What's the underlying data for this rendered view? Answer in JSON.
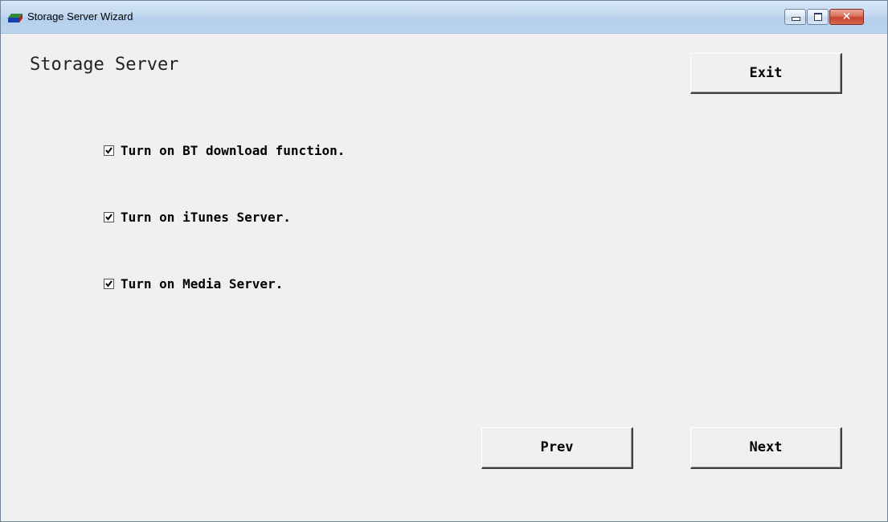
{
  "window": {
    "title": "Storage Server Wizard",
    "icon": "storage-server-icon"
  },
  "title_controls": {
    "minimize_icon": "minimize-icon",
    "maximize_icon": "maximize-icon",
    "close_icon": "close-icon",
    "close_glyph": "✕"
  },
  "page": {
    "heading": "Storage Server"
  },
  "buttons": {
    "exit": "Exit",
    "prev": "Prev",
    "next": "Next"
  },
  "options": [
    {
      "label": "Turn on BT download function.",
      "checked": true
    },
    {
      "label": "Turn on iTunes Server.",
      "checked": true
    },
    {
      "label": "Turn on Media Server.",
      "checked": true
    }
  ],
  "colors": {
    "window_background": "#f0f0f0",
    "titlebar": "#c2d9f1",
    "close_button": "#c8432b"
  }
}
